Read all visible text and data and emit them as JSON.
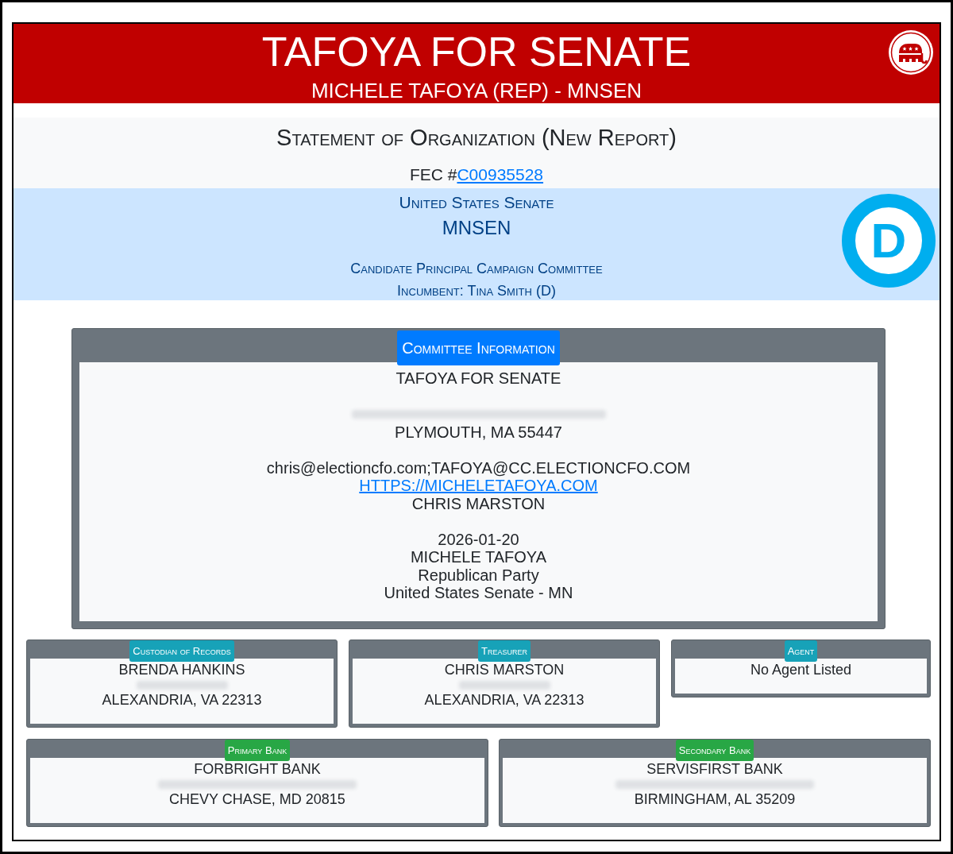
{
  "header": {
    "title": "TAFOYA FOR SENATE",
    "subtitle": "MICHELE TAFOYA (REP) - MNSEN"
  },
  "report": {
    "title": "Statement of Organization (New Report)",
    "fec_label": "FEC #",
    "fec_number": "C00935528"
  },
  "office": {
    "chamber": "United States Senate",
    "district": "MNSEN",
    "committee_type": "Candidate Principal Campaign Committee",
    "incumbent": "Incumbent: Tina Smith (D)",
    "party_logo_letter": "D"
  },
  "committee_information": {
    "heading": "Committee Information",
    "blocks": [
      [
        {
          "kind": "text",
          "text": "TAFOYA FOR SENATE"
        }
      ],
      [
        {
          "kind": "redacted"
        },
        {
          "kind": "text",
          "text": "PLYMOUTH, MA 55447"
        }
      ],
      [
        {
          "kind": "text",
          "text": "chris@electioncfo.com;TAFOYA@CC.ELECTIONCFO.COM"
        },
        {
          "kind": "link",
          "text": "HTTPS://MICHELETAFOYA.COM"
        },
        {
          "kind": "text",
          "text": "CHRIS MARSTON"
        }
      ],
      [
        {
          "kind": "text",
          "text": "2026-01-20"
        },
        {
          "kind": "text",
          "text": "MICHELE TAFOYA"
        },
        {
          "kind": "text",
          "text": "Republican Party"
        },
        {
          "kind": "text",
          "text": "United States Senate - MN"
        }
      ]
    ]
  },
  "contact_rows": [
    [
      {
        "heading": "Custodian of Records",
        "color": "#17a2b8",
        "lines": [
          {
            "kind": "text",
            "text": "BRENDA HANKINS"
          },
          {
            "kind": "redacted"
          },
          {
            "kind": "text",
            "text": "ALEXANDRIA, VA 22313"
          }
        ]
      },
      {
        "heading": "Treasurer",
        "color": "#17a2b8",
        "lines": [
          {
            "kind": "text",
            "text": "CHRIS MARSTON"
          },
          {
            "kind": "redacted"
          },
          {
            "kind": "text",
            "text": "ALEXANDRIA, VA 22313"
          }
        ]
      },
      {
        "heading": "Agent",
        "color": "#17a2b8",
        "lines": [
          {
            "kind": "text",
            "text": "No Agent Listed"
          }
        ]
      }
    ],
    [
      {
        "heading": "Primary Bank",
        "color": "#28a745",
        "lines": [
          {
            "kind": "text",
            "text": "FORBRIGHT BANK"
          },
          {
            "kind": "redacted"
          },
          {
            "kind": "text",
            "text": "CHEVY CHASE, MD 20815"
          }
        ]
      },
      {
        "heading": "Secondary Bank",
        "color": "#28a745",
        "lines": [
          {
            "kind": "text",
            "text": "SERVISFIRST BANK"
          },
          {
            "kind": "redacted"
          },
          {
            "kind": "text",
            "text": "BIRMINGHAM, AL 35209"
          }
        ]
      }
    ]
  ]
}
